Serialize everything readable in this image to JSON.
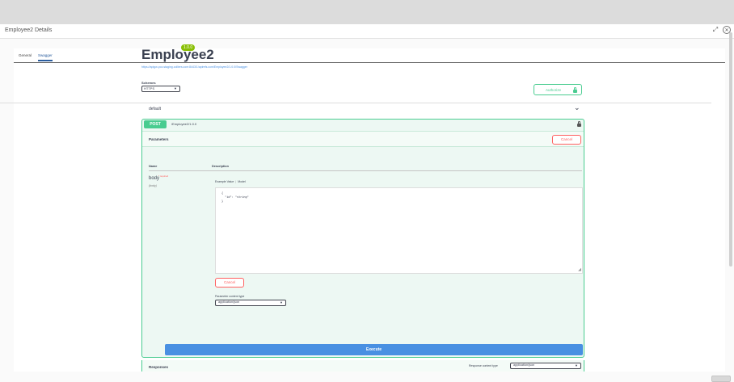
{
  "window": {
    "title": "Employee2 Details",
    "expand_icon": "expand-arrows-icon",
    "close_icon": "circle-close-icon"
  },
  "tabs": [
    {
      "label": "General",
      "active": false
    },
    {
      "label": "Swagger",
      "active": true
    }
  ],
  "swagger": {
    "title": "Employee2",
    "version_badge": "1.0.0",
    "spec_url": "https://apigw-poc.staging.colliers.com:8443/1/apirefs.com/Employee2/1.0.0/Swagger",
    "schemes": {
      "label": "Schemes",
      "selected": "HTTPS"
    },
    "authorize_label": "Authorize",
    "tag": {
      "name": "default",
      "expanded": true
    },
    "operation": {
      "method": "POST",
      "path": "/Employee2/1.0.0",
      "parameters_title": "Parameters",
      "cancel_label": "Cancel",
      "columns": {
        "name": "Name",
        "description": "Description"
      },
      "param": {
        "name": "body",
        "required": "* required",
        "in": "(body)"
      },
      "example_tabs": {
        "example_value": "Example Value",
        "model": "Model"
      },
      "body_lines": [
        "{",
        "  \"id\": \"string\"",
        "}"
      ],
      "body_cancel_label": "Cancel",
      "param_content_type": {
        "label": "Parameter content type",
        "selected": "application/json"
      },
      "execute_label": "Execute",
      "responses_title": "Responses",
      "response_content_type": {
        "label": "Response content type",
        "selected": "application/json"
      }
    }
  },
  "colors": {
    "post_green": "#49cc90",
    "execute_blue": "#4990e2",
    "cancel_red": "#ff6060",
    "text_dark": "#3b4151"
  }
}
